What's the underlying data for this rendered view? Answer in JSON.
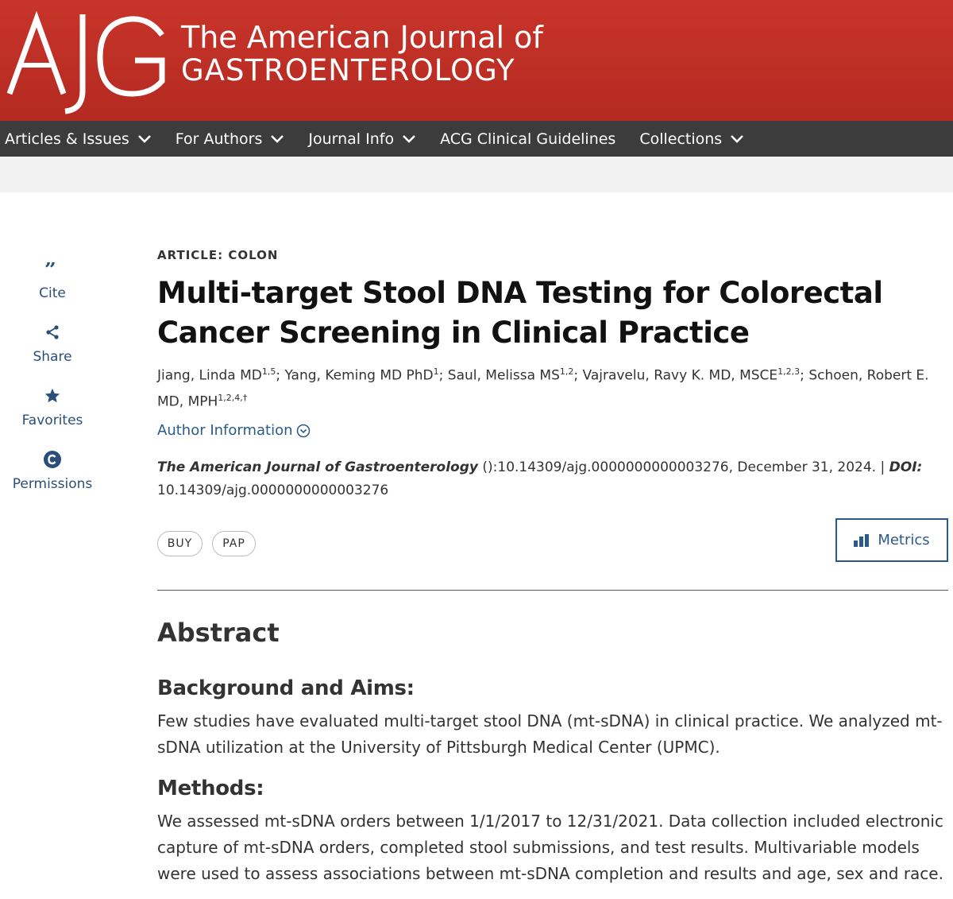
{
  "header": {
    "logo_letters": "AJG",
    "journal_line1": "The American Journal of",
    "journal_line2": "GASTROENTEROLOGY",
    "colors": {
      "banner": "#b42a21",
      "nav": "#3c3c3c",
      "link": "#2a5a8a"
    }
  },
  "nav": {
    "items": [
      {
        "label": "Articles & Issues",
        "has_dropdown": true
      },
      {
        "label": "For Authors",
        "has_dropdown": true
      },
      {
        "label": "Journal Info",
        "has_dropdown": true
      },
      {
        "label": "ACG Clinical Guidelines",
        "has_dropdown": false
      },
      {
        "label": "Collections",
        "has_dropdown": true
      }
    ]
  },
  "rail": {
    "items": [
      {
        "label": "Cite",
        "icon": "quote-icon"
      },
      {
        "label": "Share",
        "icon": "share-icon"
      },
      {
        "label": "Favorites",
        "icon": "star-icon"
      },
      {
        "label": "Permissions",
        "icon": "copyright-icon"
      }
    ]
  },
  "article": {
    "kicker": "ARTICLE: COLON",
    "title": "Multi-target Stool DNA Testing for Colorectal Cancer Screening in Clinical Practice",
    "authors": [
      {
        "name": "Jiang, Linda MD",
        "sup": "1,5",
        "sep": "; "
      },
      {
        "name": "Yang, Keming MD PhD",
        "sup": "1",
        "sep": "; "
      },
      {
        "name": "Saul, Melissa MS",
        "sup": "1,2",
        "sep": "; "
      },
      {
        "name": "Vajravelu, Ravy K. MD, MSCE",
        "sup": "1,2,3",
        "sep": "; "
      },
      {
        "name": "Schoen, Robert E. MD, MPH",
        "sup": "1,2,4,†",
        "sep": ""
      }
    ],
    "author_info_label": "Author Information",
    "citation": {
      "journal": "The American Journal of Gastroenterology",
      "details": " ():10.14309/ajg.0000000000003276, December 31, 2024. | ",
      "doi_label": "DOI:",
      "doi_value": "10.14309/ajg.0000000000003276"
    },
    "buttons": {
      "buy": "BUY",
      "pap": "PAP",
      "metrics": "Metrics"
    }
  },
  "abstract": {
    "heading": "Abstract",
    "sections": [
      {
        "heading": "Background and Aims:",
        "text": "Few studies have evaluated multi-target stool DNA (mt-sDNA) in clinical practice. We analyzed mt-sDNA utilization at the University of Pittsburgh Medical Center (UPMC)."
      },
      {
        "heading": "Methods:",
        "text": "We assessed mt-sDNA orders between 1/1/2017 to 12/31/2021. Data collection included electronic capture of mt-sDNA orders, completed stool submissions, and test results. Multivariable models were used to assess associations between mt-sDNA completion and results and age, sex and race."
      }
    ]
  }
}
